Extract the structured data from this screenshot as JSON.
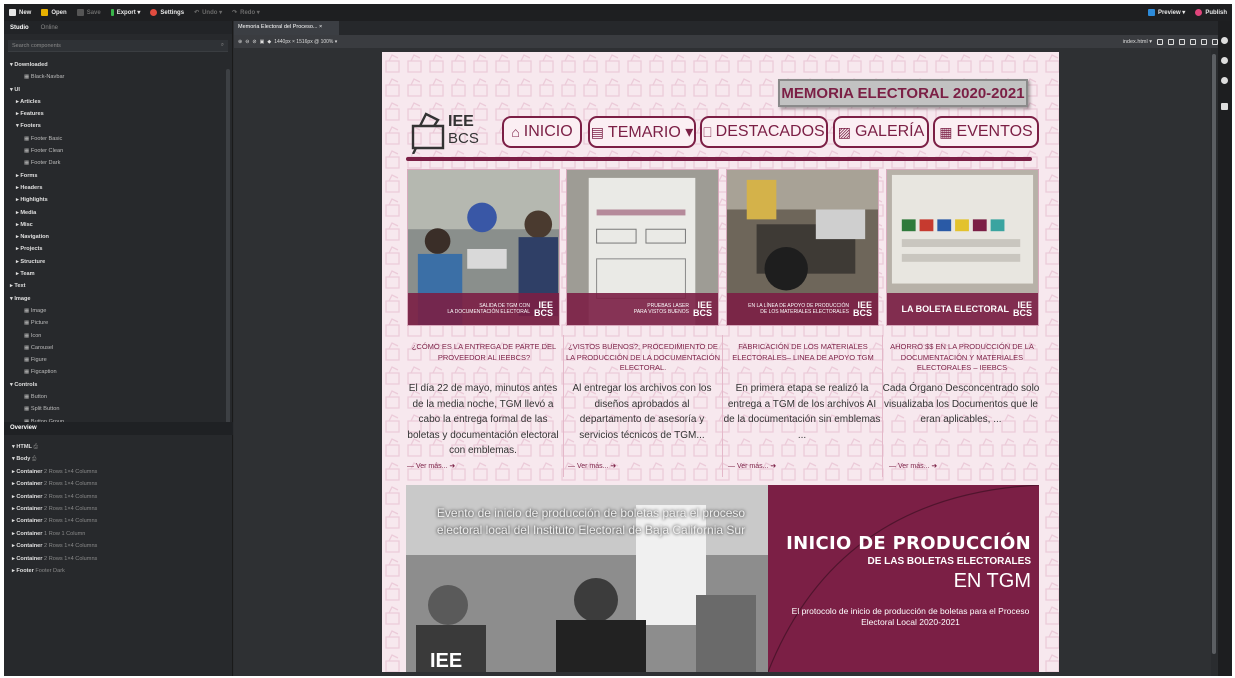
{
  "toolbar": {
    "new": "New",
    "open": "Open",
    "save": "Save",
    "export": "Export ▾",
    "settings": "Settings",
    "undo": "Undo ▾",
    "redo": "Redo ▾",
    "preview": "Preview ▾",
    "publish": "Publish"
  },
  "panel": {
    "tab_studio": "Studio",
    "tab_online": "Online",
    "search_placeholder": "Search components",
    "tree": [
      {
        "label": "▾ Downloaded",
        "level": 0
      },
      {
        "label": "▦ Black-Navbar",
        "level": 2
      },
      {
        "label": "▾ UI",
        "level": 0
      },
      {
        "label": "▸ Articles",
        "level": 1
      },
      {
        "label": "▸ Features",
        "level": 1
      },
      {
        "label": "▾ Footers",
        "level": 1
      },
      {
        "label": "▦ Footer Basic",
        "level": 2
      },
      {
        "label": "▦ Footer Clean",
        "level": 2
      },
      {
        "label": "▦ Footer Dark",
        "level": 2
      },
      {
        "label": "▸ Forms",
        "level": 1
      },
      {
        "label": "▸ Headers",
        "level": 1
      },
      {
        "label": "▸ Highlights",
        "level": 1
      },
      {
        "label": "▸ Media",
        "level": 1
      },
      {
        "label": "▸ Misc",
        "level": 1
      },
      {
        "label": "▸ Navigation",
        "level": 1
      },
      {
        "label": "▸ Projects",
        "level": 1
      },
      {
        "label": "▸ Structure",
        "level": 1
      },
      {
        "label": "▸ Team",
        "level": 1
      },
      {
        "label": "▸ Text",
        "level": 0
      },
      {
        "label": "▾ Image",
        "level": 0
      },
      {
        "label": "▦ Image",
        "level": 2
      },
      {
        "label": "▦ Picture",
        "level": 2
      },
      {
        "label": "▦ Icon",
        "level": 2
      },
      {
        "label": "▦ Carousel",
        "level": 2
      },
      {
        "label": "▦ Figure",
        "level": 2
      },
      {
        "label": "▦ Figcaption",
        "level": 2
      },
      {
        "label": "▾ Controls",
        "level": 0
      },
      {
        "label": "▦ Button",
        "level": 2
      },
      {
        "label": "▦ Split Button",
        "level": 2
      },
      {
        "label": "▦ Button Group",
        "level": 2
      }
    ],
    "overview_title": "Overview",
    "overview": [
      {
        "name": "▾ HTML",
        "desc": "⎙"
      },
      {
        "name": "▾ Body",
        "desc": "⎙"
      },
      {
        "name": "▸ Container",
        "desc": "2 Rows 1×4 Columns"
      },
      {
        "name": "▸ Container",
        "desc": "2 Rows 1×4 Columns"
      },
      {
        "name": "▸ Container",
        "desc": "2 Rows 1×4 Columns"
      },
      {
        "name": "▸ Container",
        "desc": "2 Rows 1×4 Columns"
      },
      {
        "name": "▸ Container",
        "desc": "2 Rows 1×4 Columns"
      },
      {
        "name": "▸ Container",
        "desc": "1 Row 1 Column"
      },
      {
        "name": "▸ Container",
        "desc": "2 Rows 1×4 Columns"
      },
      {
        "name": "▸ Container",
        "desc": "2 Rows 1×4 Columns"
      },
      {
        "name": "▸ Footer",
        "desc": "Footer Dark"
      }
    ]
  },
  "editor": {
    "doc_tab": "Memoria Electoral del Proceso... ×",
    "zoom_info": "1440px × 1516px @ 100% ▾",
    "file_select": "index.html ▾"
  },
  "site": {
    "banner": "MEMORIA ELECTORAL 2020-2021",
    "logo_line1": "IEE",
    "logo_line2": "BCS",
    "nav": [
      {
        "label": "INICIO",
        "icon": "⌂"
      },
      {
        "label": "TEMARIO ▾",
        "icon": "▤"
      },
      {
        "label": "DESTACADOS",
        "icon": "⎕"
      },
      {
        "label": "GALERÍA",
        "icon": "▨"
      },
      {
        "label": "EVENTOS",
        "icon": "▦"
      }
    ],
    "cards": [
      {
        "caption": "SALIDA DE TGM CON\nLA DOCUMENTACIÓN ELECTORAL",
        "title": "¿CÓMO ES LA ENTREGA DE PARTE DEL PROVEEDOR AL IEEBCS?",
        "text": "El día 22 de mayo, minutos antes de la media noche, TGM llevó a cabo la entrega formal de las boletas y documentación electoral con emblemas.",
        "more": "— Ver más... ➜"
      },
      {
        "caption": "PRUEBAS LASER\nPARA VISTOS BUENOS",
        "title": "¿VISTOS BUENOS?, PROCEDIMIENTO DE LA PRODUCCIÓN DE LA DOCUMENTACIÓN ELECTORAL.",
        "text": "Al entregar los archivos con los diseños aprobados al departamento de asesoría y servicios técnicos de TGM...",
        "more": "— Ver más... ➜"
      },
      {
        "caption": "EN LA LÍNEA DE APOYO DE PRODUCCIÓN\nDE LOS MATERIALES ELECTORALES",
        "title": "FABRICACIÓN DE LOS MATERIALES ELECTORALES– LINEA DE APOYO TGM",
        "text": "En primera etapa se realizó la entrega a TGM de los archivos AI de la documentación sin emblemas ...",
        "more": "— Ver más... ➜"
      },
      {
        "caption": "LA BOLETA ELECTORAL",
        "title": "AHORRO $$ EN LA PRODUCCIÓN DE LA DOCUMENTACIÓN Y MATERIALES ELECTORALES – IEEBCS",
        "text": "Cada Órgano Desconcentrado solo visualizaba los Documentos que le eran aplicables, ...",
        "more": "— Ver más... ➜"
      }
    ],
    "card_logo_1": "IEE",
    "card_logo_2": "BCS",
    "feature": {
      "photo_caption": "Evento de inicio de producción de boletas para el proceso electoral local del Instituto Electoral de Baja California Sur",
      "title1": "INICIO DE PRODUCCIÓN",
      "title2": "DE LAS BOLETAS ELECTORALES",
      "title3": "EN TGM",
      "desc": "El protocolo de inicio de producción de boletas para el Proceso Electoral Local 2020-2021",
      "corner_logo": "IEE"
    },
    "colors": {
      "brand": "#7b1f45",
      "page_bg": "#f7e8ee"
    }
  }
}
